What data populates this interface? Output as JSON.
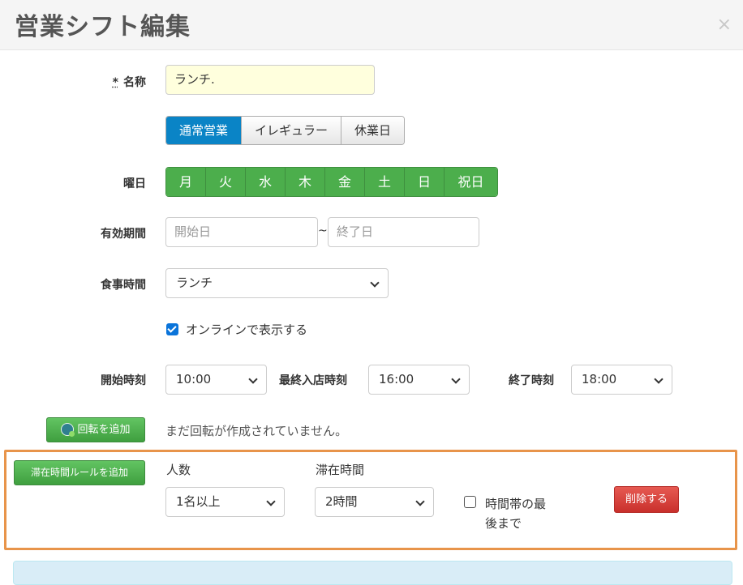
{
  "modal": {
    "title": "営業シフト編集",
    "close": "×"
  },
  "form": {
    "name_required_mark": "*",
    "name_label": "名称",
    "name_value": "ランチ.",
    "types": [
      "通常営業",
      "イレギュラー",
      "休業日"
    ],
    "active_type": "通常営業",
    "weekday_label": "曜日",
    "weekdays": [
      "月",
      "火",
      "水",
      "木",
      "金",
      "土",
      "日",
      "祝日"
    ],
    "period_label": "有効期間",
    "start_date_placeholder": "開始日",
    "period_separator": "~",
    "end_date_placeholder": "終了日",
    "meal_label": "食事時間",
    "meal_value": "ランチ",
    "online_checked": true,
    "online_label": "オンラインで表示する",
    "start_time_label": "開始時刻",
    "start_time_value": "10:00",
    "last_entry_label": "最終入店時刻",
    "last_entry_value": "16:00",
    "end_time_label": "終了時刻",
    "end_time_value": "18:00",
    "add_rotation_button": "回転を追加",
    "no_rotation_text": "まだ回転が作成されていません。"
  },
  "stay_rule": {
    "add_button": "滞在時間ルールを追加",
    "people_label": "人数",
    "people_value": "1名以上",
    "duration_label": "滞在時間",
    "duration_value": "2時間",
    "until_end_checked": false,
    "until_end_label_line1": "時間帯の最",
    "until_end_label_line2": "後まで",
    "delete_button": "削除する"
  },
  "colors": {
    "primary": "#0a84c6",
    "success": "#4cae4c",
    "danger": "#c9302c",
    "highlight_border": "#e8944a",
    "info_bg": "#d9edf7"
  }
}
